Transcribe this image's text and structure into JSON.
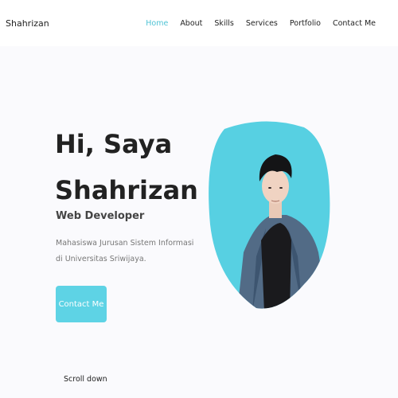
{
  "brand": "Shahrizan",
  "nav": {
    "items": [
      {
        "label": "Home",
        "active": true
      },
      {
        "label": "About",
        "active": false
      },
      {
        "label": "Skills",
        "active": false
      },
      {
        "label": "Services",
        "active": false
      },
      {
        "label": "Portfolio",
        "active": false
      },
      {
        "label": "Contact Me",
        "active": false
      }
    ]
  },
  "hero": {
    "title_line1": "Hi, Saya",
    "title_line2": "Shahrizan",
    "subtitle": "Web Developer",
    "description": "Mahasiswa Jurusan Sistem Informasi di Universitas Sriwijaya.",
    "button_label": "Contact Me"
  },
  "scroll": {
    "label": "Scroll down"
  },
  "colors": {
    "accent": "#5ed3e5",
    "active_nav": "#4fc3d5",
    "background": "#fafafd"
  }
}
